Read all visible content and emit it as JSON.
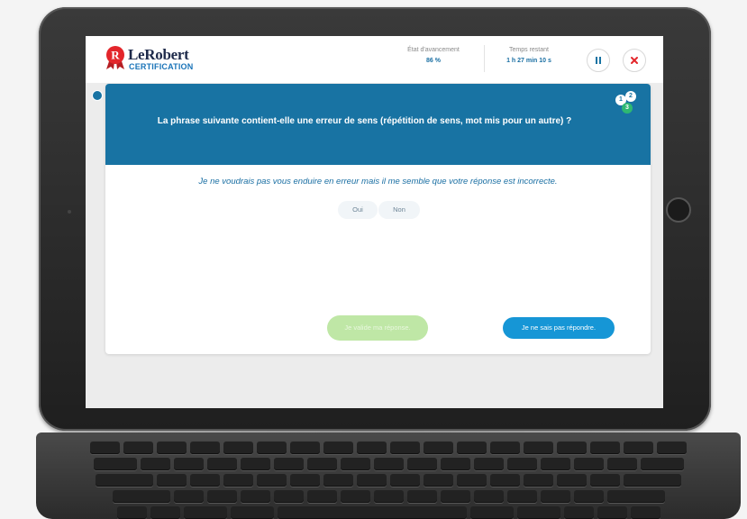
{
  "header": {
    "logo": {
      "name": "LeRobert",
      "sub": "CERTIFICATION"
    },
    "progress": {
      "label": "État d'avancement",
      "value": "86 %"
    },
    "time": {
      "label": "Temps restant",
      "value": "1 h 27 min 10 s"
    },
    "pause_icon": "pause-icon",
    "close_icon": "close-icon"
  },
  "question": {
    "title": "La phrase suivante contient-elle une erreur de sens (répétition de sens, mot mis pour un autre) ?",
    "sentence": "Je ne voudrais pas vous enduire en erreur mais il me semble que votre réponse est incorrecte.",
    "choices": [
      "Oui",
      "Non"
    ],
    "badges": [
      "1",
      "2",
      "3"
    ]
  },
  "actions": {
    "validate": "Je valide ma réponse.",
    "dont_know": "Je ne sais pas répondre."
  },
  "colors": {
    "primary": "#1873a3",
    "accent_blue": "#1696d6",
    "validate_disabled": "#bfe7a6",
    "logo_red": "#e3262b",
    "close_red": "#e3262b"
  }
}
